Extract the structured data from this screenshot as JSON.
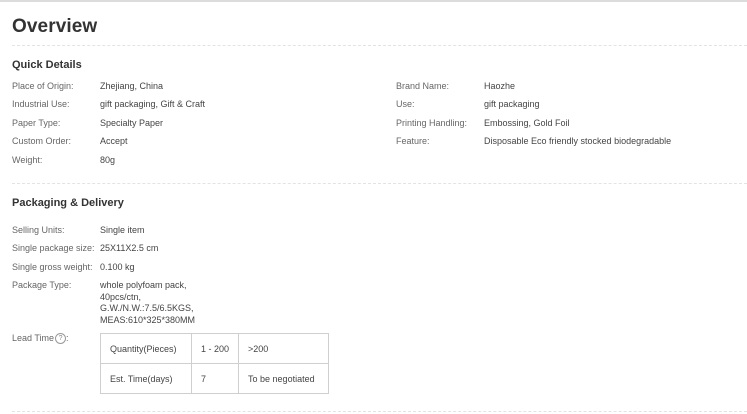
{
  "overview": {
    "title": "Overview"
  },
  "quick_details": {
    "title": "Quick Details",
    "left": [
      {
        "label": "Place of Origin:",
        "value": "Zhejiang, China"
      },
      {
        "label": "Industrial Use:",
        "value": "gift packaging, Gift & Craft"
      },
      {
        "label": "Paper Type:",
        "value": "Specialty Paper"
      },
      {
        "label": "Custom Order:",
        "value": "Accept"
      },
      {
        "label": "Weight:",
        "value": "80g"
      }
    ],
    "right": [
      {
        "label": "Brand Name:",
        "value": "Haozhe"
      },
      {
        "label": "Use:",
        "value": "gift packaging"
      },
      {
        "label": "Printing Handling:",
        "value": "Embossing, Gold Foil"
      },
      {
        "label": "Feature:",
        "value": "Disposable Eco friendly stocked biodegradable"
      }
    ]
  },
  "packaging": {
    "title": "Packaging & Delivery",
    "rows": [
      {
        "label": "Selling Units:",
        "value": "Single item"
      },
      {
        "label": "Single package size:",
        "value": "25X11X2.5 cm"
      },
      {
        "label": "Single gross weight:",
        "value": "0.100 kg"
      }
    ],
    "package_type": {
      "label": "Package Type:",
      "lines": [
        "whole polyfoam pack,",
        "40pcs/ctn,",
        "G.W./N.W.:7.5/6.5KGS,",
        "MEAS:610*325*380MM"
      ]
    },
    "lead_time": {
      "label": "Lead Time",
      "help_icon": "question-circle-icon",
      "help_glyph": "?",
      "suffix": ":",
      "table": [
        [
          "Quantity(Pieces)",
          "1 - 200",
          ">200"
        ],
        [
          "Est. Time(days)",
          "7",
          "To be negotiated"
        ]
      ]
    }
  }
}
